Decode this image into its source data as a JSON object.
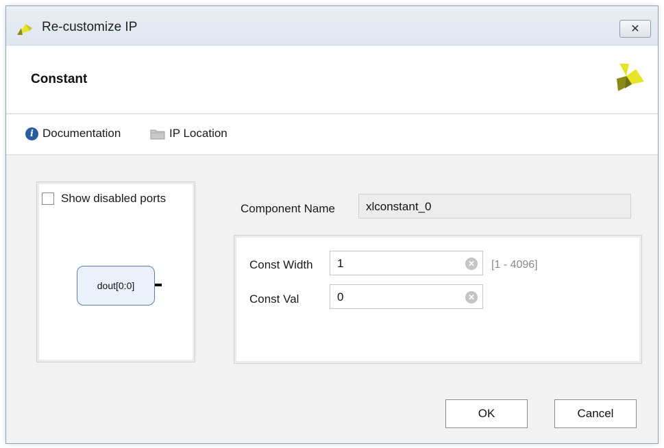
{
  "window": {
    "title": "Re-customize IP",
    "close_glyph": "✕"
  },
  "header": {
    "title": "Constant"
  },
  "toolbar": {
    "documentation_label": "Documentation",
    "ip_location_label": "IP Location"
  },
  "left_panel": {
    "show_disabled_ports_label": "Show disabled ports",
    "show_disabled_ports_checked": false,
    "port_name": "dout[0:0]"
  },
  "component": {
    "label": "Component Name",
    "value": "xlconstant_0"
  },
  "params": {
    "const_width": {
      "label": "Const Width",
      "value": "1",
      "range": "[1 - 4096]"
    },
    "const_val": {
      "label": "Const Val",
      "value": "0"
    }
  },
  "buttons": {
    "ok_label": "OK",
    "cancel_label": "Cancel"
  },
  "icons": {
    "app_logo": "xilinx-logo-icon",
    "info": "info-icon",
    "folder": "folder-icon",
    "clear": "clear-icon"
  },
  "colors": {
    "logo_yellow": "#e6e42a",
    "logo_olive": "#8a8a18",
    "info_blue": "#2a5d9f",
    "port_border": "#5b7fb6"
  }
}
